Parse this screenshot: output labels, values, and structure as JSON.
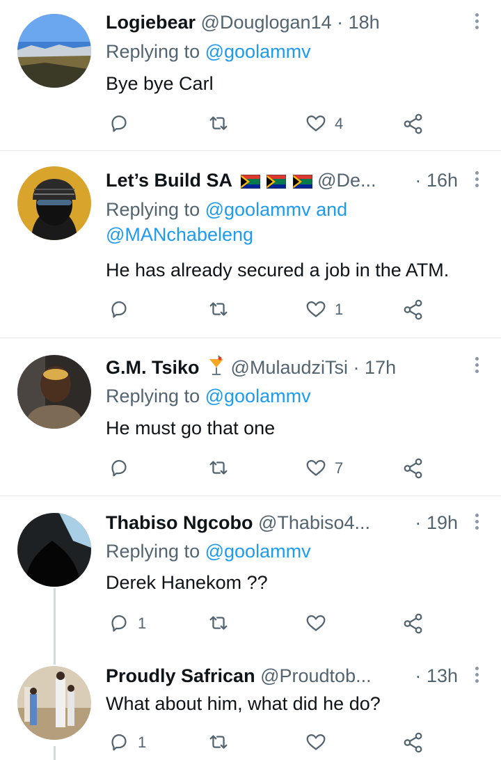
{
  "tweets": [
    {
      "name": "Logiebear",
      "handle": "@Douglogan14",
      "time": "18h",
      "reply_prefix": "Replying to",
      "mentions": [
        "@goolammv"
      ],
      "text": "Bye bye Carl",
      "reply_count": "",
      "like_count": "4"
    },
    {
      "name": "Let’s Build SA",
      "handle": "@De...",
      "time": "16h",
      "reply_prefix": "Replying to",
      "mentions": [
        "@goolammv",
        "@MANchabeleng"
      ],
      "mention_joiner": "and",
      "text": "He has already secured a job in the ATM.",
      "reply_count": "",
      "like_count": "1"
    },
    {
      "name": "G.M. Tsiko",
      "handle": "@MulaudziTsi",
      "time": "17h",
      "reply_prefix": "Replying to",
      "mentions": [
        "@goolammv"
      ],
      "text": "He must go that one",
      "reply_count": "",
      "like_count": "7"
    },
    {
      "name": "Thabiso Ngcobo",
      "handle": "@Thabiso4...",
      "time": "19h",
      "reply_prefix": "Replying to",
      "mentions": [
        "@goolammv"
      ],
      "text": "Derek Hanekom ??",
      "reply_count": "1",
      "like_count": ""
    },
    {
      "name": "Proudly Safrican",
      "handle": "@Proudtob...",
      "time": "13h",
      "text": "What about him, what did he do?",
      "reply_count": "1",
      "like_count": ""
    }
  ],
  "separator": "·",
  "icons": {
    "reply": "reply-icon",
    "retweet": "retweet-icon",
    "like": "heart-icon",
    "share": "share-icon",
    "more": "more-vertical-icon",
    "cocktail": "cocktail-emoji-icon",
    "flag": "south-africa-flag-icon"
  },
  "colors": {
    "text": "#0f1419",
    "secondary": "#536471",
    "link": "#1d9bf0",
    "divider": "#e6e6e6"
  }
}
